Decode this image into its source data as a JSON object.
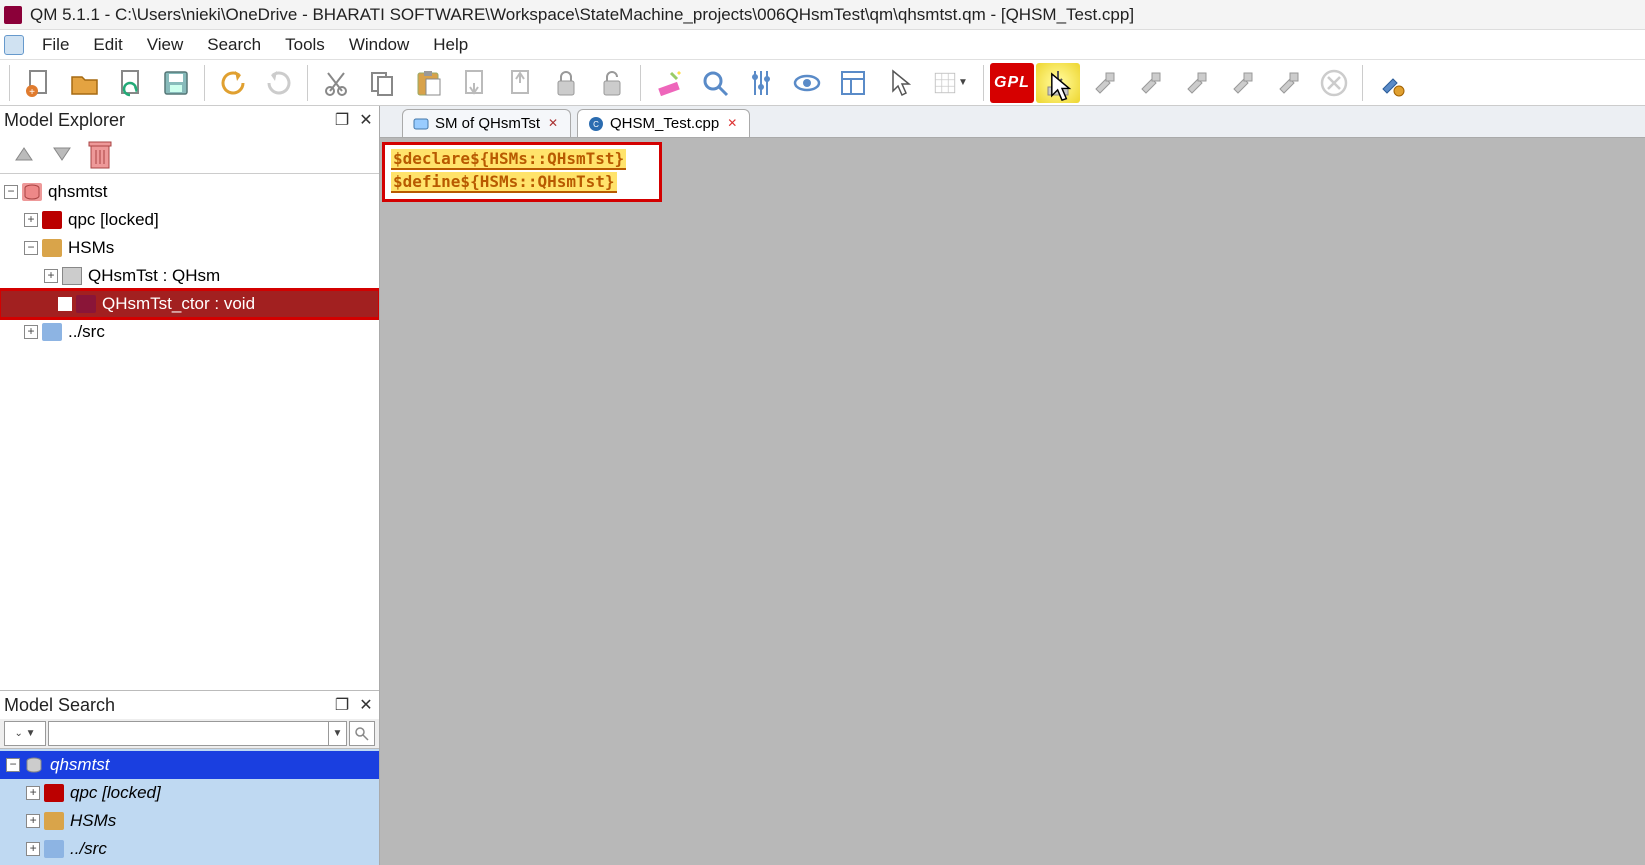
{
  "title": "QM 5.1.1 - C:\\Users\\nieki\\OneDrive - BHARATI SOFTWARE\\Workspace\\StateMachine_projects\\006QHsmTest\\qm\\qhsmtst.qm - [QHSM_Test.cpp]",
  "menu": [
    "File",
    "Edit",
    "View",
    "Search",
    "Tools",
    "Window",
    "Help"
  ],
  "toolbar": {
    "gpl_label": "GPL"
  },
  "explorer": {
    "title": "Model Explorer",
    "tree": {
      "root": "qhsmtst",
      "qpc": "qpc [locked]",
      "hsms": "HSMs",
      "qhsmtst_class": "QHsmTst : QHsm",
      "qhsmtst_ctor": "QHsmTst_ctor : void",
      "src": "../src"
    }
  },
  "search": {
    "title": "Model Search",
    "input_value": "",
    "tree": {
      "root": "qhsmtst",
      "qpc": "qpc [locked]",
      "hsms": "HSMs",
      "src": "../src"
    }
  },
  "tabs": [
    {
      "label": "SM of QHsmTst"
    },
    {
      "label": "QHSM_Test.cpp"
    }
  ],
  "code": {
    "line1": "$declare${HSMs::QHsmTst}",
    "line2": "$define${HSMs::QHsmTst}"
  }
}
